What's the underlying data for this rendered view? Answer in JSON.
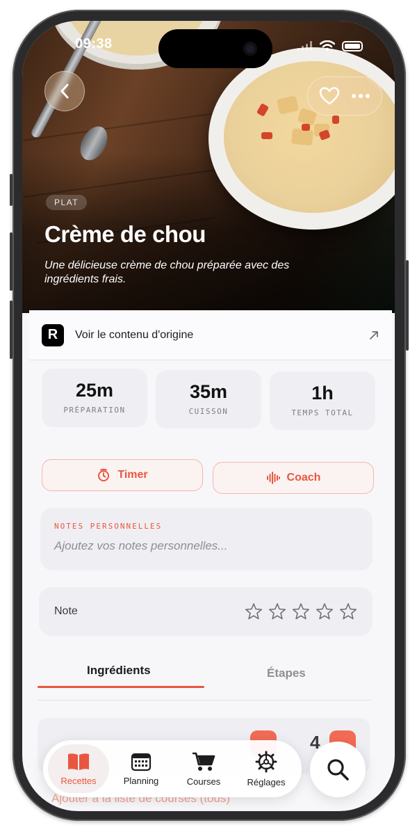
{
  "status": {
    "time": "09:38"
  },
  "recipe": {
    "category": "PLAT",
    "title": "Crème de chou",
    "description": "Une délicieuse crème de chou préparée avec des ingrédients frais."
  },
  "origin": {
    "logo_letter": "R",
    "label": "Voir le contenu d'origine"
  },
  "times": [
    {
      "value": "25m",
      "label": "PRÉPARATION"
    },
    {
      "value": "35m",
      "label": "CUISSON"
    },
    {
      "value": "1h",
      "label": "TEMPS TOTAL"
    }
  ],
  "actions": {
    "timer": "Timer",
    "coach": "Coach"
  },
  "notes": {
    "label": "NOTES PERSONNELLES",
    "placeholder": "Ajoutez vos notes personnelles..."
  },
  "rating": {
    "label": "Note",
    "value": 0,
    "max": 5
  },
  "tabs": {
    "ingredients": "Ingrédients",
    "steps": "Étapes",
    "active": "ingredients"
  },
  "servings": {
    "value": "4"
  },
  "shopping": {
    "label": "Ajouter à la liste de courses  (tous)"
  },
  "tabbar": {
    "items": [
      {
        "label": "Recettes",
        "icon": "book-icon",
        "active": true
      },
      {
        "label": "Planning",
        "icon": "calendar-icon",
        "active": false
      },
      {
        "label": "Courses",
        "icon": "cart-icon",
        "active": false
      },
      {
        "label": "Réglages",
        "icon": "gear-icon",
        "active": false
      }
    ]
  },
  "colors": {
    "accent": "#e8563f",
    "card": "#efeff3"
  }
}
